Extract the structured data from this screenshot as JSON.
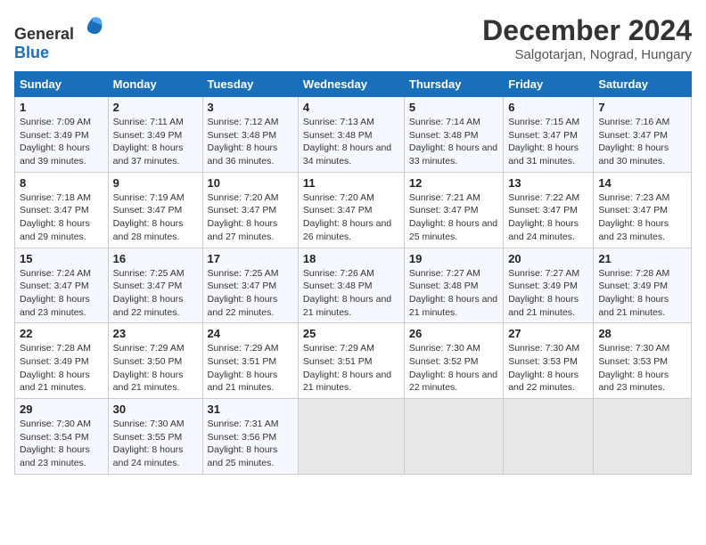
{
  "header": {
    "logo_general": "General",
    "logo_blue": "Blue",
    "title": "December 2024",
    "subtitle": "Salgotarjan, Nograd, Hungary"
  },
  "days_of_week": [
    "Sunday",
    "Monday",
    "Tuesday",
    "Wednesday",
    "Thursday",
    "Friday",
    "Saturday"
  ],
  "weeks": [
    [
      {
        "day": 1,
        "sunrise": "7:09 AM",
        "sunset": "3:49 PM",
        "daylight": "8 hours and 39 minutes."
      },
      {
        "day": 2,
        "sunrise": "7:11 AM",
        "sunset": "3:49 PM",
        "daylight": "8 hours and 37 minutes."
      },
      {
        "day": 3,
        "sunrise": "7:12 AM",
        "sunset": "3:48 PM",
        "daylight": "8 hours and 36 minutes."
      },
      {
        "day": 4,
        "sunrise": "7:13 AM",
        "sunset": "3:48 PM",
        "daylight": "8 hours and 34 minutes."
      },
      {
        "day": 5,
        "sunrise": "7:14 AM",
        "sunset": "3:48 PM",
        "daylight": "8 hours and 33 minutes."
      },
      {
        "day": 6,
        "sunrise": "7:15 AM",
        "sunset": "3:47 PM",
        "daylight": "8 hours and 31 minutes."
      },
      {
        "day": 7,
        "sunrise": "7:16 AM",
        "sunset": "3:47 PM",
        "daylight": "8 hours and 30 minutes."
      }
    ],
    [
      {
        "day": 8,
        "sunrise": "7:18 AM",
        "sunset": "3:47 PM",
        "daylight": "8 hours and 29 minutes."
      },
      {
        "day": 9,
        "sunrise": "7:19 AM",
        "sunset": "3:47 PM",
        "daylight": "8 hours and 28 minutes."
      },
      {
        "day": 10,
        "sunrise": "7:20 AM",
        "sunset": "3:47 PM",
        "daylight": "8 hours and 27 minutes."
      },
      {
        "day": 11,
        "sunrise": "7:20 AM",
        "sunset": "3:47 PM",
        "daylight": "8 hours and 26 minutes."
      },
      {
        "day": 12,
        "sunrise": "7:21 AM",
        "sunset": "3:47 PM",
        "daylight": "8 hours and 25 minutes."
      },
      {
        "day": 13,
        "sunrise": "7:22 AM",
        "sunset": "3:47 PM",
        "daylight": "8 hours and 24 minutes."
      },
      {
        "day": 14,
        "sunrise": "7:23 AM",
        "sunset": "3:47 PM",
        "daylight": "8 hours and 23 minutes."
      }
    ],
    [
      {
        "day": 15,
        "sunrise": "7:24 AM",
        "sunset": "3:47 PM",
        "daylight": "8 hours and 23 minutes."
      },
      {
        "day": 16,
        "sunrise": "7:25 AM",
        "sunset": "3:47 PM",
        "daylight": "8 hours and 22 minutes."
      },
      {
        "day": 17,
        "sunrise": "7:25 AM",
        "sunset": "3:47 PM",
        "daylight": "8 hours and 22 minutes."
      },
      {
        "day": 18,
        "sunrise": "7:26 AM",
        "sunset": "3:48 PM",
        "daylight": "8 hours and 21 minutes."
      },
      {
        "day": 19,
        "sunrise": "7:27 AM",
        "sunset": "3:48 PM",
        "daylight": "8 hours and 21 minutes."
      },
      {
        "day": 20,
        "sunrise": "7:27 AM",
        "sunset": "3:49 PM",
        "daylight": "8 hours and 21 minutes."
      },
      {
        "day": 21,
        "sunrise": "7:28 AM",
        "sunset": "3:49 PM",
        "daylight": "8 hours and 21 minutes."
      }
    ],
    [
      {
        "day": 22,
        "sunrise": "7:28 AM",
        "sunset": "3:49 PM",
        "daylight": "8 hours and 21 minutes."
      },
      {
        "day": 23,
        "sunrise": "7:29 AM",
        "sunset": "3:50 PM",
        "daylight": "8 hours and 21 minutes."
      },
      {
        "day": 24,
        "sunrise": "7:29 AM",
        "sunset": "3:51 PM",
        "daylight": "8 hours and 21 minutes."
      },
      {
        "day": 25,
        "sunrise": "7:29 AM",
        "sunset": "3:51 PM",
        "daylight": "8 hours and 21 minutes."
      },
      {
        "day": 26,
        "sunrise": "7:30 AM",
        "sunset": "3:52 PM",
        "daylight": "8 hours and 22 minutes."
      },
      {
        "day": 27,
        "sunrise": "7:30 AM",
        "sunset": "3:53 PM",
        "daylight": "8 hours and 22 minutes."
      },
      {
        "day": 28,
        "sunrise": "7:30 AM",
        "sunset": "3:53 PM",
        "daylight": "8 hours and 23 minutes."
      }
    ],
    [
      {
        "day": 29,
        "sunrise": "7:30 AM",
        "sunset": "3:54 PM",
        "daylight": "8 hours and 23 minutes."
      },
      {
        "day": 30,
        "sunrise": "7:30 AM",
        "sunset": "3:55 PM",
        "daylight": "8 hours and 24 minutes."
      },
      {
        "day": 31,
        "sunrise": "7:31 AM",
        "sunset": "3:56 PM",
        "daylight": "8 hours and 25 minutes."
      },
      null,
      null,
      null,
      null
    ]
  ]
}
